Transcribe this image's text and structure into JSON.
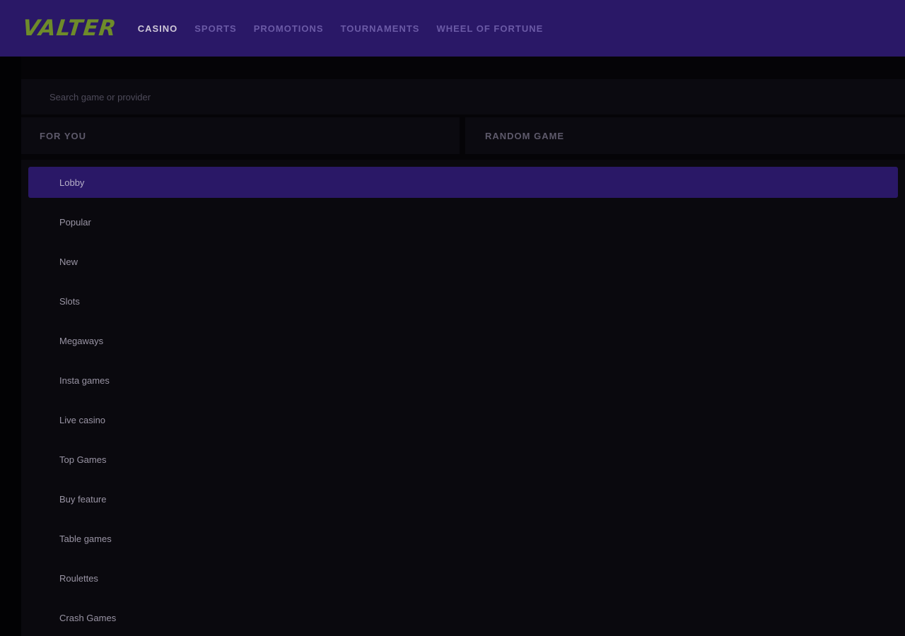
{
  "header": {
    "logo": "VALTER",
    "nav": [
      {
        "label": "CASINO",
        "active": true
      },
      {
        "label": "SPORTS",
        "active": false
      },
      {
        "label": "PROMOTIONS",
        "active": false
      },
      {
        "label": "TOURNAMENTS",
        "active": false
      },
      {
        "label": "WHEEL OF FORTUNE",
        "active": false
      }
    ]
  },
  "search": {
    "placeholder": "Search game or provider",
    "value": ""
  },
  "quick_tabs": {
    "for_you": "FOR YOU",
    "random_game": "RANDOM GAME"
  },
  "categories": [
    {
      "label": "Lobby",
      "active": true
    },
    {
      "label": "Popular",
      "active": false
    },
    {
      "label": "New",
      "active": false
    },
    {
      "label": "Slots",
      "active": false
    },
    {
      "label": "Megaways",
      "active": false
    },
    {
      "label": "Insta games",
      "active": false
    },
    {
      "label": "Live casino",
      "active": false
    },
    {
      "label": "Top Games",
      "active": false
    },
    {
      "label": "Buy feature",
      "active": false
    },
    {
      "label": "Table games",
      "active": false
    },
    {
      "label": "Roulettes",
      "active": false
    },
    {
      "label": "Crash Games",
      "active": false
    }
  ],
  "colors": {
    "header_bg": "#2a1867",
    "logo": "#6e8b2a",
    "active_category_bg": "#2a1867",
    "page_bg": "#050407"
  }
}
